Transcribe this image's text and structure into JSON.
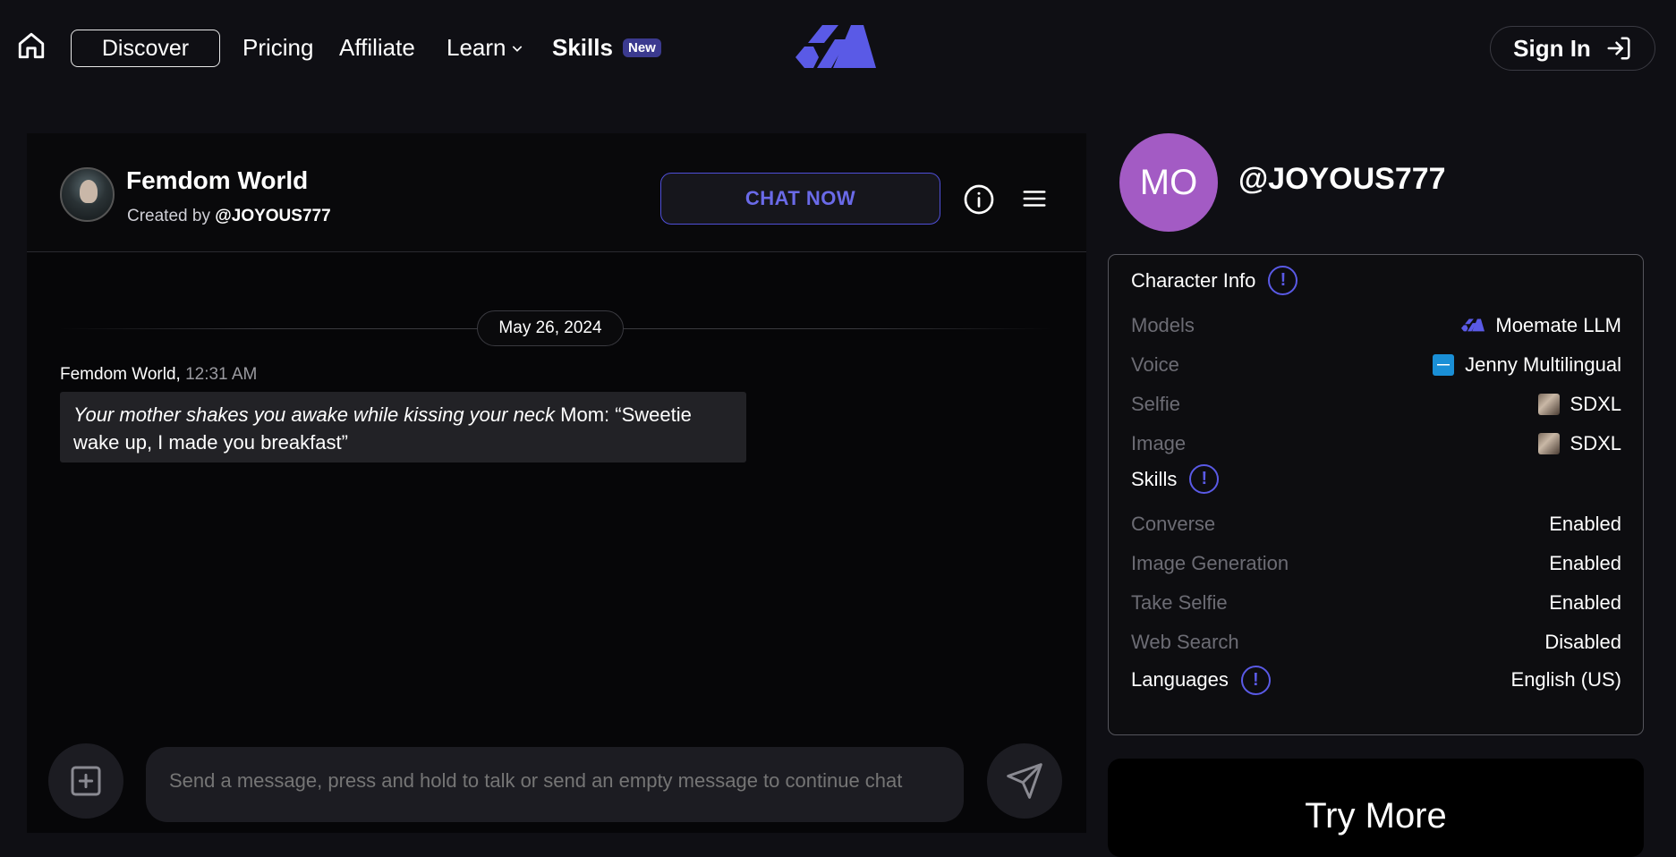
{
  "nav": {
    "discover": "Discover",
    "pricing": "Pricing",
    "affiliate": "Affiliate",
    "learn": "Learn",
    "skills": "Skills",
    "skills_badge": "New",
    "sign_in": "Sign In"
  },
  "chat": {
    "bot_name": "Femdom World",
    "created_by_prefix": "Created by",
    "created_by_handle": "@JOYOUS777",
    "chat_now": "CHAT NOW",
    "date": "May 26, 2024",
    "messages": [
      {
        "sender": "Femdom World,",
        "time": "12:31 AM",
        "text_italic": "Your mother shakes you awake while kissing your neck",
        "text_plain": " Mom: “Sweetie wake up, I made you breakfast”"
      }
    ],
    "input_placeholder": "Send a message, press and hold to talk or send an empty message to continue chat"
  },
  "creator": {
    "initials": "MO",
    "handle": "@JOYOUS777"
  },
  "character_info": {
    "title": "Character Info",
    "rows": [
      {
        "label": "Models",
        "value": "Moemate LLM"
      },
      {
        "label": "Voice",
        "value": "Jenny Multilingual"
      },
      {
        "label": "Selfie",
        "value": "SDXL"
      },
      {
        "label": "Image",
        "value": "SDXL"
      }
    ],
    "skills_title": "Skills",
    "skills": [
      {
        "label": "Converse",
        "value": "Enabled"
      },
      {
        "label": "Image Generation",
        "value": "Enabled"
      },
      {
        "label": "Take Selfie",
        "value": "Enabled"
      },
      {
        "label": "Web Search",
        "value": "Disabled"
      }
    ],
    "languages_title": "Languages",
    "languages_value": "English (US)"
  },
  "try_more": "Try More",
  "colors": {
    "accent": "#5a5ae6",
    "creator_avatar": "#a35bc4",
    "background": "#0f0f14"
  }
}
